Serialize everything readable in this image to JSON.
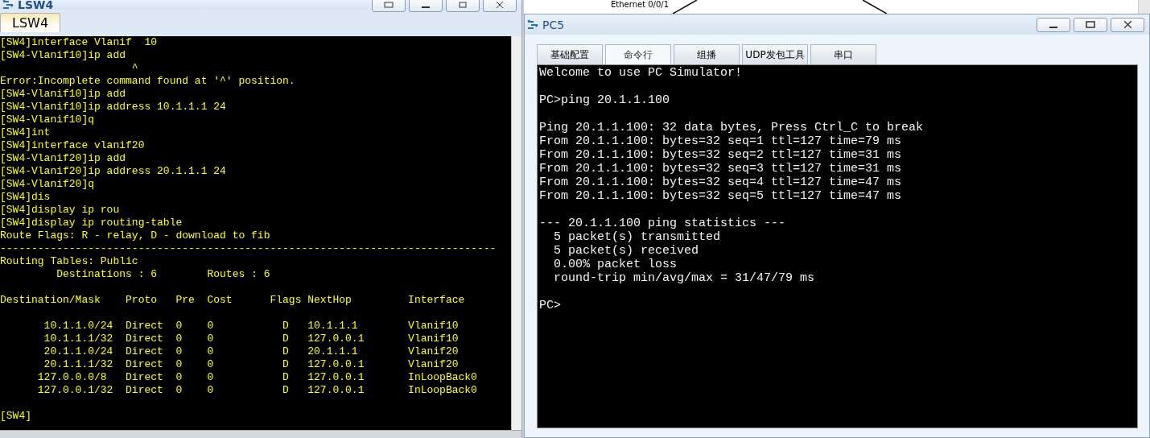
{
  "left_window": {
    "title": "LSW4",
    "tabs": [
      {
        "label": "LSW4",
        "selected": true
      }
    ],
    "terminal": {
      "blocks": [
        [
          "[SW4]interface Vlanif  10",
          "[SW4-Vlanif10]ip add",
          "                     ^",
          "Error:Incomplete command found at '^' position.",
          "[SW4-Vlanif10]ip add",
          "[SW4-Vlanif10]ip address 10.1.1.1 24",
          "[SW4-Vlanif10]q",
          "[SW4]int",
          "[SW4]interface vlanif20",
          "[SW4-Vlanif20]ip add",
          "[SW4-Vlanif20]ip address 20.1.1.1 24",
          "[SW4-Vlanif20]q",
          "[SW4]dis",
          "[SW4]display ip rou",
          "[SW4]display ip routing-table",
          "Route Flags: R - relay, D - download to fib",
          "-------------------------------------------------------------------------------",
          "Routing Tables: Public",
          "         Destinations : 6        Routes : 6"
        ],
        [
          "Destination/Mask    Proto   Pre  Cost      Flags NextHop         Interface"
        ],
        [
          "       10.1.1.0/24  Direct  0    0           D   10.1.1.1        Vlanif10",
          "       10.1.1.1/32  Direct  0    0           D   127.0.0.1       Vlanif10",
          "       20.1.1.0/24  Direct  0    0           D   20.1.1.1        Vlanif20",
          "       20.1.1.1/32  Direct  0    0           D   127.0.0.1       Vlanif20",
          "      127.0.0.0/8   Direct  0    0           D   127.0.0.1       InLoopBack0",
          "      127.0.0.1/32  Direct  0    0           D   127.0.0.1       InLoopBack0"
        ],
        [
          "[SW4]"
        ]
      ]
    }
  },
  "topology": {
    "label": "Ethernet 0/0/1"
  },
  "pc_window": {
    "title": "PC5",
    "tabs": [
      {
        "label": "基础配置",
        "selected": false
      },
      {
        "label": "命令行",
        "selected": true
      },
      {
        "label": "组播",
        "selected": false
      },
      {
        "label": "UDP发包工具",
        "selected": false
      },
      {
        "label": "串口",
        "selected": false
      }
    ],
    "terminal": {
      "blocks": [
        [
          "Welcome to use PC Simulator!"
        ],
        [
          "PC>ping 20.1.1.100"
        ],
        [
          "Ping 20.1.1.100: 32 data bytes, Press Ctrl_C to break",
          "From 20.1.1.100: bytes=32 seq=1 ttl=127 time=79 ms",
          "From 20.1.1.100: bytes=32 seq=2 ttl=127 time=31 ms",
          "From 20.1.1.100: bytes=32 seq=3 ttl=127 time=31 ms",
          "From 20.1.1.100: bytes=32 seq=4 ttl=127 time=47 ms",
          "From 20.1.1.100: bytes=32 seq=5 ttl=127 time=47 ms"
        ],
        [
          "--- 20.1.1.100 ping statistics ---",
          "  5 packet(s) transmitted",
          "  5 packet(s) received",
          "  0.00% packet loss",
          "  round-trip min/avg/max = 31/47/79 ms"
        ],
        [
          "PC>"
        ]
      ]
    }
  }
}
